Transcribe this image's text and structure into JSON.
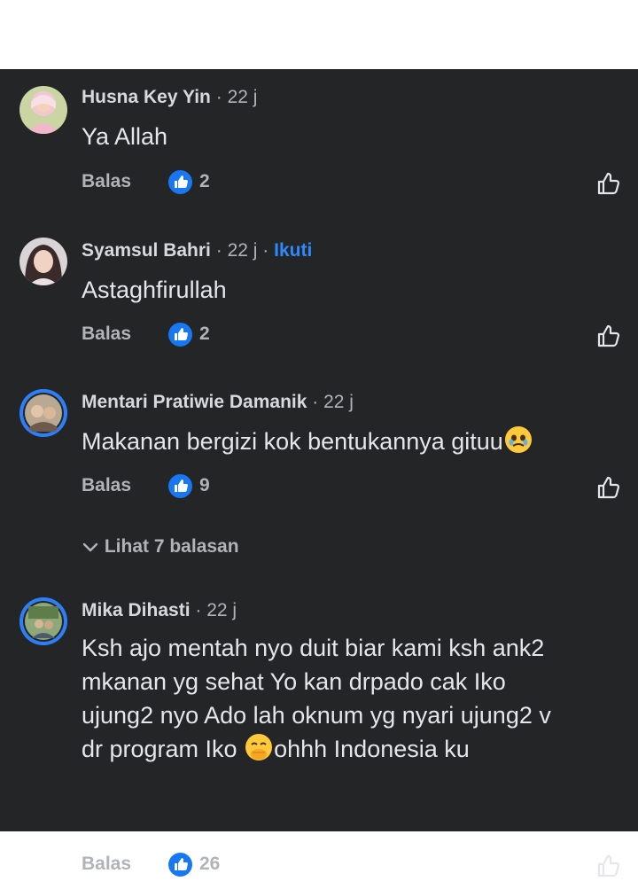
{
  "comments": [
    {
      "author": "Husna Key Yin",
      "time": "22 j",
      "text": "Ya Allah",
      "reply_label": "Balas",
      "likes": "2"
    },
    {
      "author": "Syamsul Bahri",
      "time": "22 j",
      "follow_label": "Ikuti",
      "text": "Astaghfirullah",
      "reply_label": "Balas",
      "likes": "2"
    },
    {
      "author": "Mentari Pratiwie Damanik",
      "time": "22 j",
      "text": "Makanan bergizi kok bentukannya gituu",
      "reply_label": "Balas",
      "likes": "9",
      "view_replies": "Lihat 7 balasan"
    },
    {
      "author": "Mika Dihasti",
      "time": "22 j",
      "text_lines": [
        "Ksh ajo mentah nyo duit biar kami ksh ank2",
        "mkanan yg sehat Yo kan drpado cak Iko",
        "ujung2 nyo Ado lah oknum yg nyari ujung2 v",
        "dr program Iko",
        "ohhh Indonesia ku"
      ],
      "reply_label": "Balas",
      "likes": "26"
    }
  ],
  "icons": {
    "like_badge": "thumbs-up-filled",
    "like_button": "thumbs-up-outline",
    "chevron": "chevron-down",
    "emoji_1": "face-holding-back-tears",
    "emoji_2": "face-with-hand-over-mouth"
  },
  "colors": {
    "background": "#242526",
    "accent": "#1877f2",
    "follow": "#2e89ff"
  }
}
